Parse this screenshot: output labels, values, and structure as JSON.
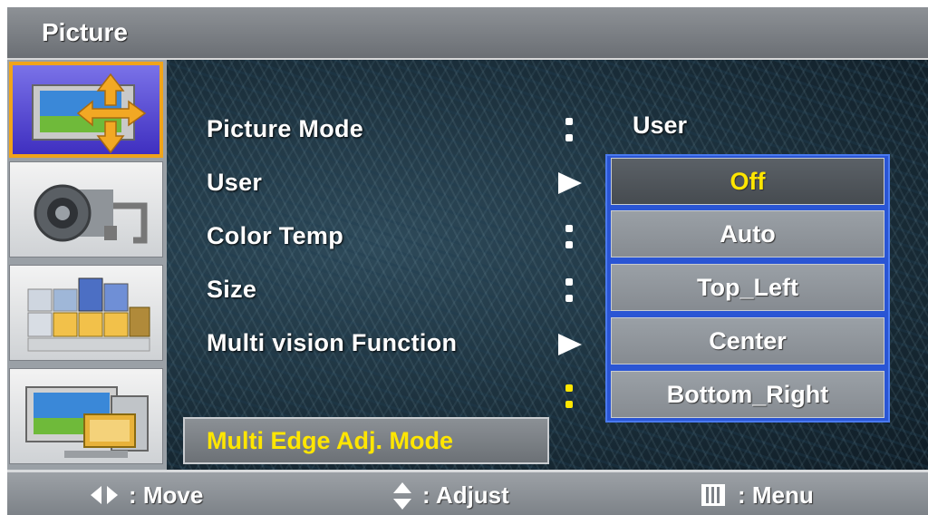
{
  "window": {
    "title": "Picture"
  },
  "sidebar": {
    "items": [
      {
        "icon": "picture-icon",
        "active": true
      },
      {
        "icon": "sound-icon",
        "active": false
      },
      {
        "icon": "setup-icon",
        "active": false
      },
      {
        "icon": "input-icon",
        "active": false
      }
    ]
  },
  "menu": {
    "items": [
      {
        "label": "Picture Mode",
        "indicator": "colon",
        "value": "User"
      },
      {
        "label": "User",
        "indicator": "arrow"
      },
      {
        "label": "Color Temp",
        "indicator": "colon"
      },
      {
        "label": "Size",
        "indicator": "colon"
      },
      {
        "label": "Multi vision Function",
        "indicator": "arrow"
      },
      {
        "label": "Multi Edge Adj. Mode",
        "indicator": "colon",
        "selected": true
      }
    ]
  },
  "dropdown": {
    "options": [
      "Off",
      "Auto",
      "Top_Left",
      "Center",
      "Bottom_Right"
    ],
    "selected": "Off"
  },
  "footer": {
    "move_label": ": Move",
    "adjust_label": ": Adjust",
    "menu_label": ": Menu"
  },
  "colors": {
    "highlight_text": "#ffe600",
    "dropdown_border": "#2a55d4",
    "active_tile_border": "#f0a41a"
  }
}
